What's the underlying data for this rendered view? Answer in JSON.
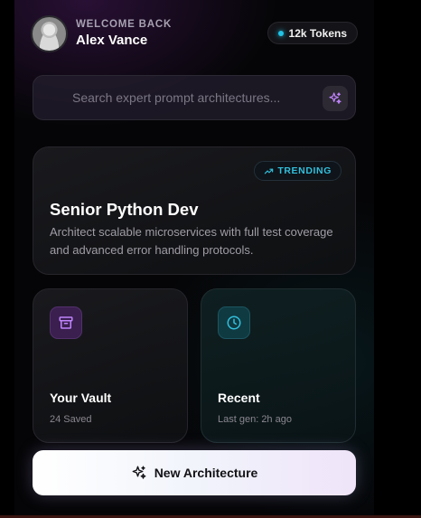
{
  "header": {
    "greeting": "WELCOME BACK",
    "user_name": "Alex Vance",
    "tokens_label": "12k Tokens"
  },
  "search": {
    "placeholder": "Search expert prompt architectures..."
  },
  "featured": {
    "badge": "TRENDING",
    "title": "Senior Python Dev",
    "description": "Architect scalable microservices with full test coverage and advanced error handling protocols."
  },
  "tiles": [
    {
      "title": "Your Vault",
      "subtitle": "24 Saved",
      "icon": "archive-icon"
    },
    {
      "title": "Recent",
      "subtitle": "Last gen: 2h ago",
      "icon": "clock-icon"
    }
  ],
  "cta": {
    "label": "New Architecture",
    "icon": "sparkles-icon"
  },
  "colors": {
    "accent_cyan": "#32bfdc",
    "accent_purple": "#b377f0"
  }
}
